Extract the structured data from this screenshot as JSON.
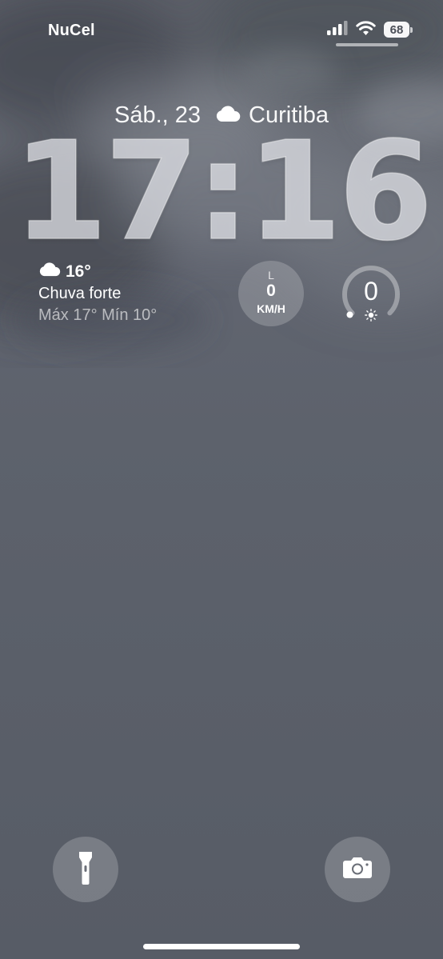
{
  "status_bar": {
    "carrier": "NuCel",
    "battery_level": "68",
    "icons": [
      "signal-bars-icon",
      "wifi-icon",
      "battery-icon"
    ]
  },
  "lock_screen": {
    "date": "Sáb., 23",
    "city": "Curitiba",
    "time": "17:16"
  },
  "weather_widget": {
    "icon": "cloud-icon",
    "temperature": "16°",
    "condition": "Chuva forte",
    "range": "Máx 17° Mín 10°"
  },
  "wind_widget": {
    "direction": "L",
    "speed": "0",
    "unit": "KM/H"
  },
  "uv_widget": {
    "value": "0",
    "icon": "sun-icon"
  },
  "quick_actions": {
    "left_icon": "flashlight-icon",
    "right_icon": "camera-icon"
  },
  "colors": {
    "background": "#5a5f69",
    "text": "#ffffff",
    "widget_bg": "rgba(255,255,255,0.2)"
  }
}
